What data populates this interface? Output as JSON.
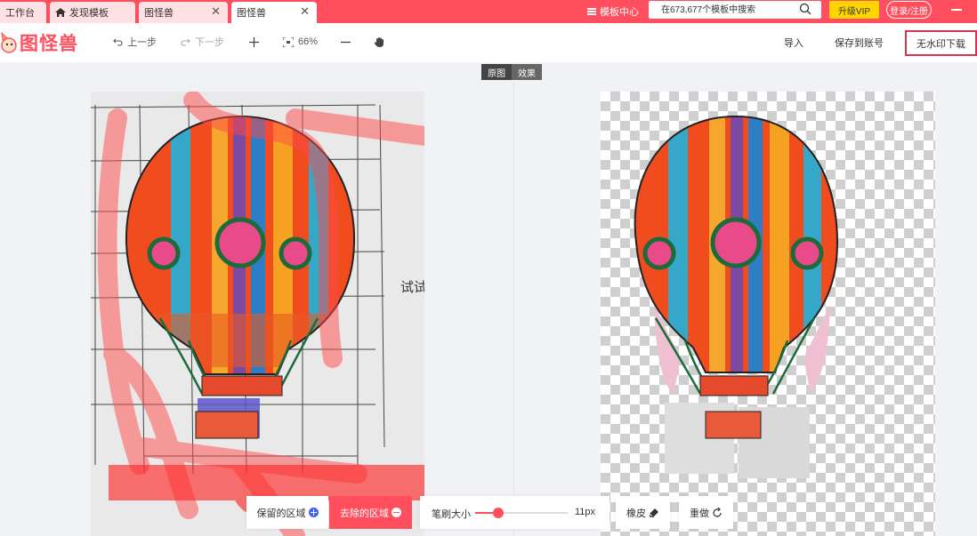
{
  "tabs": [
    {
      "label": "工作台",
      "active": false
    },
    {
      "label": "发现模板",
      "active": false,
      "icon": "home-icon"
    },
    {
      "label": "图怪兽",
      "active": false,
      "closable": true
    },
    {
      "label": "图怪兽",
      "active": true,
      "closable": true
    }
  ],
  "topbar": {
    "template_center": "模板中心",
    "search_placeholder": "在673,677个模板中搜索",
    "vip": "升级VIP",
    "login": "登录/注册"
  },
  "toolbar": {
    "logo": "图怪兽",
    "undo": "上一步",
    "redo": "下一步",
    "zoom": "66%",
    "import": "导入",
    "save_account": "保存到账号",
    "download": "无水印下载"
  },
  "view_toggle": {
    "original": "原图",
    "result": "效果"
  },
  "canvas": {
    "page_text": "试试"
  },
  "controls": {
    "keep": "保留的区域",
    "remove": "去除的区域",
    "brush_label": "笔刷大小",
    "brush_value": "11px",
    "brush_fraction": 0.25,
    "eraser": "橡皮",
    "reset": "重做"
  },
  "colors": {
    "accent": "#ff4f5e",
    "download_border": "#d9334a",
    "vip": "#ffd400"
  }
}
